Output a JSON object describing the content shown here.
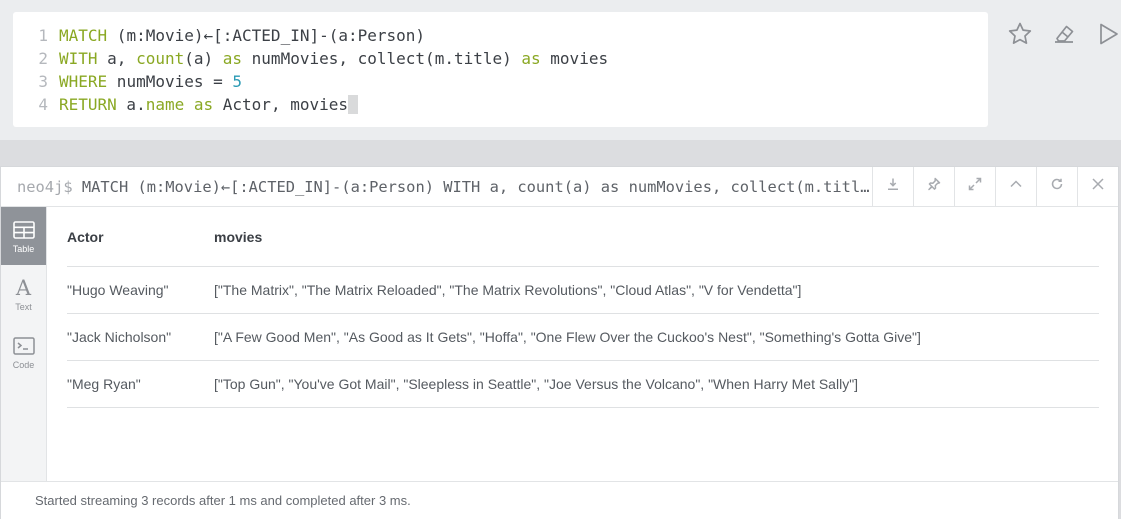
{
  "editor": {
    "lines": [
      {
        "num": "1",
        "tokens": [
          {
            "t": "MATCH",
            "c": "kw"
          },
          {
            "t": " (m:Movie)←[:ACTED_IN]-(a:Person)",
            "c": "id"
          }
        ]
      },
      {
        "num": "2",
        "tokens": [
          {
            "t": "WITH",
            "c": "kw"
          },
          {
            "t": " a, ",
            "c": "id"
          },
          {
            "t": "count",
            "c": "kw"
          },
          {
            "t": "(a) ",
            "c": "id"
          },
          {
            "t": "as",
            "c": "kw"
          },
          {
            "t": " numMovies, collect(m.title) ",
            "c": "id"
          },
          {
            "t": "as",
            "c": "kw"
          },
          {
            "t": " movies",
            "c": "id"
          }
        ]
      },
      {
        "num": "3",
        "tokens": [
          {
            "t": "WHERE",
            "c": "kw"
          },
          {
            "t": " numMovies = ",
            "c": "id"
          },
          {
            "t": "5",
            "c": "num"
          }
        ]
      },
      {
        "num": "4",
        "tokens": [
          {
            "t": "RETURN",
            "c": "kw"
          },
          {
            "t": " a.",
            "c": "id"
          },
          {
            "t": "name",
            "c": "kw"
          },
          {
            "t": " ",
            "c": "id"
          },
          {
            "t": "as",
            "c": "kw"
          },
          {
            "t": " Actor, movies",
            "c": "id"
          }
        ]
      }
    ],
    "actions": [
      "star-icon",
      "eraser-icon",
      "play-icon"
    ]
  },
  "frame": {
    "prompt": "neo4j$",
    "command": "MATCH (m:Movie)←[:ACTED_IN]-(a:Person) WITH a, count(a) as numMovies, collect(m.title) as movies WHERE numMovies = 5 RETURN a.name as Actor, movies",
    "tools": [
      "download-icon",
      "pin-icon",
      "expand-icon",
      "collapse-icon",
      "rerun-icon",
      "close-icon"
    ],
    "views": [
      {
        "label": "Table",
        "icon": "table-icon",
        "active": true
      },
      {
        "label": "Text",
        "icon": "text-icon",
        "active": false
      },
      {
        "label": "Code",
        "icon": "code-icon",
        "active": false
      }
    ],
    "table": {
      "headers": [
        "Actor",
        "movies"
      ],
      "rows": [
        [
          "\"Hugo Weaving\"",
          "[\"The Matrix\", \"The Matrix Reloaded\", \"The Matrix Revolutions\", \"Cloud Atlas\", \"V for Vendetta\"]"
        ],
        [
          "\"Jack Nicholson\"",
          "[\"A Few Good Men\", \"As Good as It Gets\", \"Hoffa\", \"One Flew Over the Cuckoo's Nest\", \"Something's Gotta Give\"]"
        ],
        [
          "\"Meg Ryan\"",
          "[\"Top Gun\", \"You've Got Mail\", \"Sleepless in Seattle\", \"Joe Versus the Volcano\", \"When Harry Met Sally\"]"
        ]
      ]
    },
    "status": "Started streaming 3 records after 1 ms and completed after 3 ms."
  }
}
